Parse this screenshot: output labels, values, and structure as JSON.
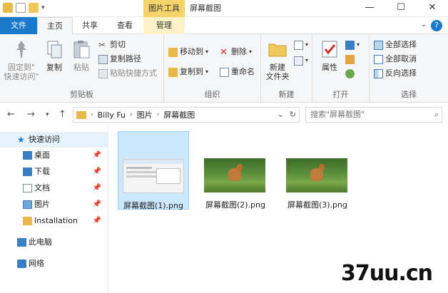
{
  "titlebar": {
    "context_tab": "图片工具",
    "title": "屏幕截图",
    "minimize": "—",
    "maximize": "☐",
    "close": "✕"
  },
  "tabs": {
    "file": "文件",
    "home": "主页",
    "share": "共享",
    "view": "查看",
    "manage": "管理"
  },
  "ribbon": {
    "clipboard": {
      "label": "剪贴板",
      "pin": "固定到\"\n快速访问\"",
      "pin_l1": "固定到\"",
      "pin_l2": "快速访问\"",
      "copy": "复制",
      "paste": "粘贴",
      "cut": "剪切",
      "copy_path": "复制路径",
      "paste_shortcut": "粘贴快捷方式"
    },
    "organize": {
      "label": "组织",
      "move_to": "移动到",
      "copy_to": "复制到",
      "delete": "删除",
      "rename": "重命名"
    },
    "new": {
      "label": "新建",
      "new_folder_l1": "新建",
      "new_folder_l2": "文件夹"
    },
    "open": {
      "label": "打开",
      "properties": "属性"
    },
    "select": {
      "label": "选择",
      "select_all": "全部选择",
      "select_none": "全部取消",
      "invert": "反向选择"
    }
  },
  "address": {
    "crumbs": [
      "Billy Fu",
      "图片",
      "屏幕截图"
    ],
    "search_placeholder": "搜索\"屏幕截图\""
  },
  "sidebar": {
    "items": [
      {
        "label": "快速访问"
      },
      {
        "label": "桌面"
      },
      {
        "label": "下载"
      },
      {
        "label": "文档"
      },
      {
        "label": "图片"
      },
      {
        "label": "Installation"
      },
      {
        "label": "此电脑"
      },
      {
        "label": "网络"
      }
    ]
  },
  "files": [
    {
      "name": "屏幕截图(1).png"
    },
    {
      "name": "屏幕截图(2).png"
    },
    {
      "name": "屏幕截图(3).png"
    }
  ],
  "watermark": "37uu.cn",
  "colors": {
    "accent": "#1979ca",
    "context_tab": "#f6d36a",
    "selection": "#cce8ff"
  }
}
